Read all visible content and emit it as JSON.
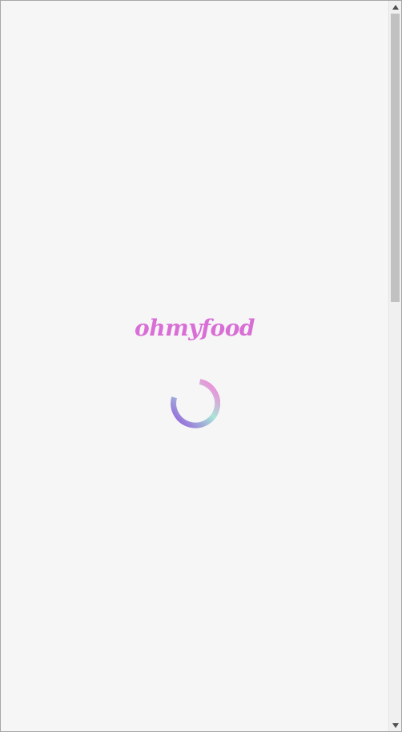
{
  "app": {
    "logo_text": "ohmyfood"
  },
  "spinner": {
    "state": "loading"
  },
  "colors": {
    "logo": "#d86ed6",
    "spinner_gradient_start": "#9356dc",
    "spinner_gradient_mid": "#a9e4d7",
    "spinner_gradient_end": "#ff79da",
    "background": "#f6f6f6"
  },
  "scrollbar": {
    "up_arrow_icon": "triangle-up-icon",
    "down_arrow_icon": "triangle-down-icon"
  }
}
